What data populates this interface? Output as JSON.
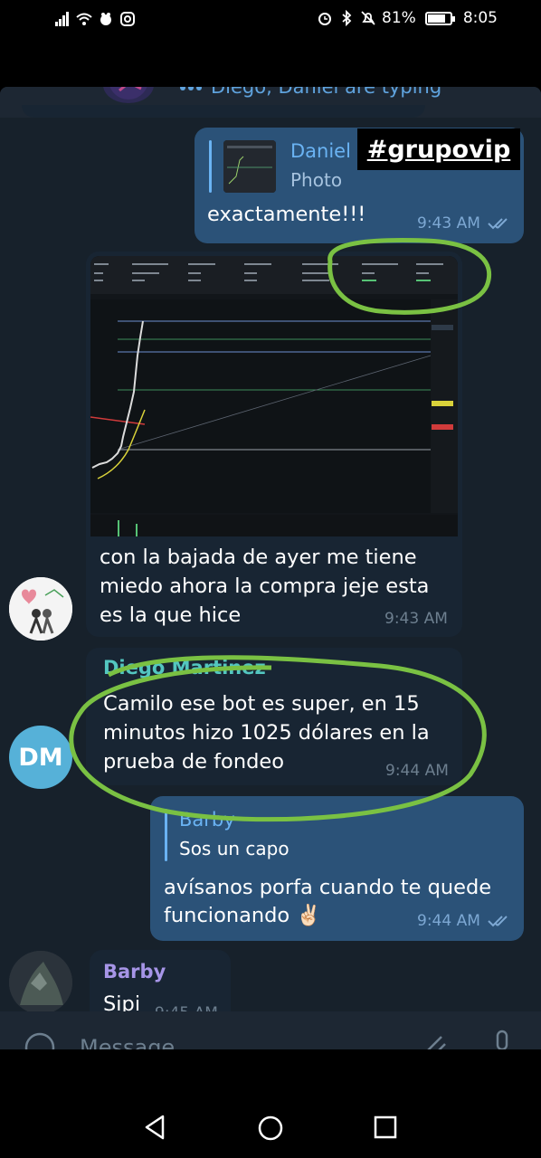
{
  "status_bar": {
    "battery": "81%",
    "battery_level": 0.81,
    "time": "8:05"
  },
  "header": {
    "typing_text": "Diego, Daniel are typing"
  },
  "overlay": {
    "hashtag": "#grupovip"
  },
  "messages": [
    {
      "direction": "out",
      "reply_name": "Daniel",
      "reply_sub": "Photo",
      "text": "exactamente!!!",
      "time": "9:43 AM"
    },
    {
      "direction": "in",
      "has_photo": true,
      "text_line1": "con la bajada de ayer me tiene",
      "text_line2": "miedo ahora la compra jeje esta",
      "text_line3": "es la que hice",
      "time": "9:43 AM"
    },
    {
      "direction": "in",
      "sender": "Diego Martinez",
      "avatar_initials": "DM",
      "text_line1": "Camilo ese bot es super, en 15",
      "text_line2": "minutos hizo 1025 dólares en la",
      "text_line3": "prueba de fondeo",
      "time": "9:44 AM"
    },
    {
      "direction": "out",
      "reply_name": "Barby",
      "reply_sub": "Sos un capo",
      "text_line1": "avísanos porfa cuando te quede",
      "text_line2": "funcionando ✌🏻",
      "time": "9:44 AM"
    },
    {
      "direction": "in",
      "sender": "Barby",
      "text": "Sipi",
      "time": "9:45 AM"
    }
  ],
  "composer": {
    "placeholder": "Message"
  },
  "colors": {
    "chat_bg": "#17212b",
    "bubble_out": "#2b5278",
    "bubble_in": "#182533",
    "accent": "#6ab3f3",
    "highlight_circle": "#7ac143"
  }
}
